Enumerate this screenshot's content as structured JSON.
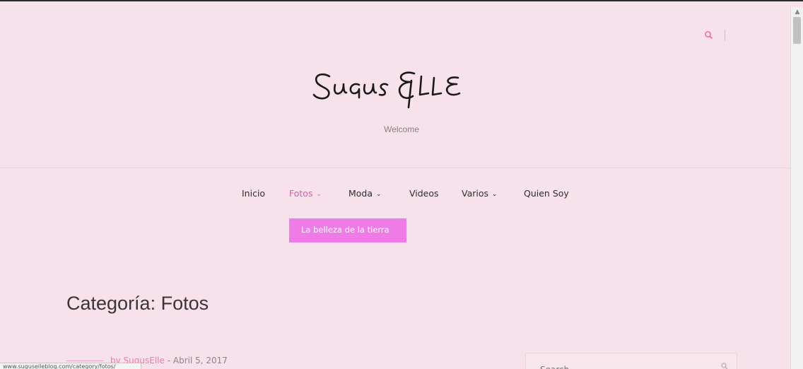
{
  "site": {
    "logo_text": "SugusElle",
    "tagline": "Welcome"
  },
  "nav": {
    "items": [
      {
        "label": "Inicio",
        "has_dropdown": false
      },
      {
        "label": "Fotos",
        "has_dropdown": true,
        "active": true
      },
      {
        "label": "Moda",
        "has_dropdown": true
      },
      {
        "label": "Videos",
        "has_dropdown": false
      },
      {
        "label": "Varios",
        "has_dropdown": true
      },
      {
        "label": "Quien Soy",
        "has_dropdown": false
      }
    ],
    "dropdown_item": "La belleza de la tierra"
  },
  "page": {
    "title": "Categoría: Fotos"
  },
  "post": {
    "by": "by",
    "author": "SugusElle",
    "date": "- Abril 5, 2017"
  },
  "sidebar": {
    "search_placeholder": "Search"
  },
  "status_bar": {
    "url": "www.suguselleblog.com/category/fotos/"
  },
  "colors": {
    "background": "#f7e1ea",
    "accent": "#e05aa8",
    "dropdown_bg": "#ee7be6"
  },
  "icons": {
    "search": "search-icon",
    "chevron": "chevron-down-icon"
  }
}
